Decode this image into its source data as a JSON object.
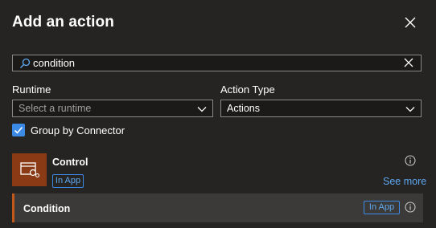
{
  "panel": {
    "title": "Add an action"
  },
  "search": {
    "value": "condition"
  },
  "filters": {
    "runtime_label": "Runtime",
    "runtime_placeholder": "Select a runtime",
    "action_type_label": "Action Type",
    "action_type_value": "Actions"
  },
  "group_by": {
    "label": "Group by Connector",
    "checked": true
  },
  "connector": {
    "name": "Control",
    "badge": "In App",
    "see_more": "See more",
    "icon": "control-icon",
    "icon_bg": "#8a3a14"
  },
  "actions": [
    {
      "name": "Condition",
      "badge": "In App"
    }
  ],
  "colors": {
    "background": "#252423",
    "accent_blue": "#3b8ae6",
    "row_accent": "#c2591b"
  }
}
